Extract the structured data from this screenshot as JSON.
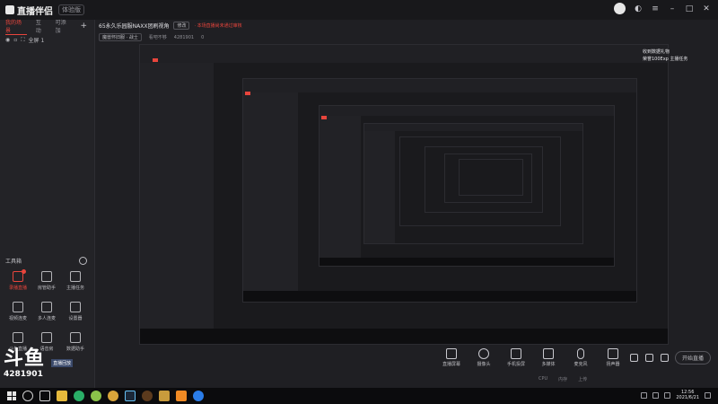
{
  "app": {
    "name": "直播伴侣",
    "version_badge": "体验版"
  },
  "left_tabs": [
    {
      "label": "我的场景",
      "active": true
    },
    {
      "label": "互动",
      "active": false
    },
    {
      "label": "可添加",
      "active": false
    }
  ],
  "scene": {
    "name": "全屏 1"
  },
  "room": {
    "title": "65永久乐园服NAXX团刷视角",
    "edit_label": "修改",
    "warning": "· 本场直播尚未通过审核",
    "category": "魔兽怀旧服 · 战士",
    "viewer_text": "看吧不够",
    "room_id": "4281901",
    "hot": "0"
  },
  "toolbox": {
    "title": "工具箱",
    "items": [
      {
        "label": "录播直播",
        "icon": "record-icon",
        "red": true,
        "badge": true
      },
      {
        "label": "房管助手",
        "icon": "manager-icon",
        "red": false,
        "badge": false
      },
      {
        "label": "主播任务",
        "icon": "task-icon",
        "red": false,
        "badge": false
      },
      {
        "label": "视频连麦",
        "icon": "video-link-icon",
        "red": false,
        "badge": false
      },
      {
        "label": "多人连麦",
        "icon": "multi-link-icon",
        "red": false,
        "badge": false
      },
      {
        "label": "设置器",
        "icon": "settings-icon",
        "red": false,
        "badge": false
      },
      {
        "label": "斗鱼直播",
        "icon": "broadcast-icon",
        "red": false,
        "badge": false
      },
      {
        "label": "语音房",
        "icon": "voice-icon",
        "red": false,
        "badge": false
      },
      {
        "label": "数据助手",
        "icon": "data-icon",
        "red": false,
        "badge": false
      }
    ]
  },
  "watermark": {
    "logo_text": "斗鱼",
    "tag": "直播回放",
    "number": "4281901"
  },
  "notice": {
    "line1": "收到数据礼物",
    "line2": "荣誉100Exp 主播任务"
  },
  "controls": [
    {
      "label": "直播屏幕",
      "icon": "screen-icon"
    },
    {
      "label": "摄像头",
      "icon": "camera-icon"
    },
    {
      "label": "手机投屏",
      "icon": "phone-cast-icon"
    },
    {
      "label": "多媒体",
      "icon": "media-icon"
    },
    {
      "label": "麦克风",
      "icon": "mic-icon"
    },
    {
      "label": "扬声器",
      "icon": "speaker-icon"
    }
  ],
  "start_button": {
    "label": "开始直播"
  },
  "status": [
    "CPU",
    "内存",
    "上传"
  ],
  "clock": {
    "time": "12:56",
    "date": "2021/6/21"
  },
  "colors": {
    "accent": "#e8453c",
    "background": "#1f1f23",
    "panel": "#232327"
  }
}
